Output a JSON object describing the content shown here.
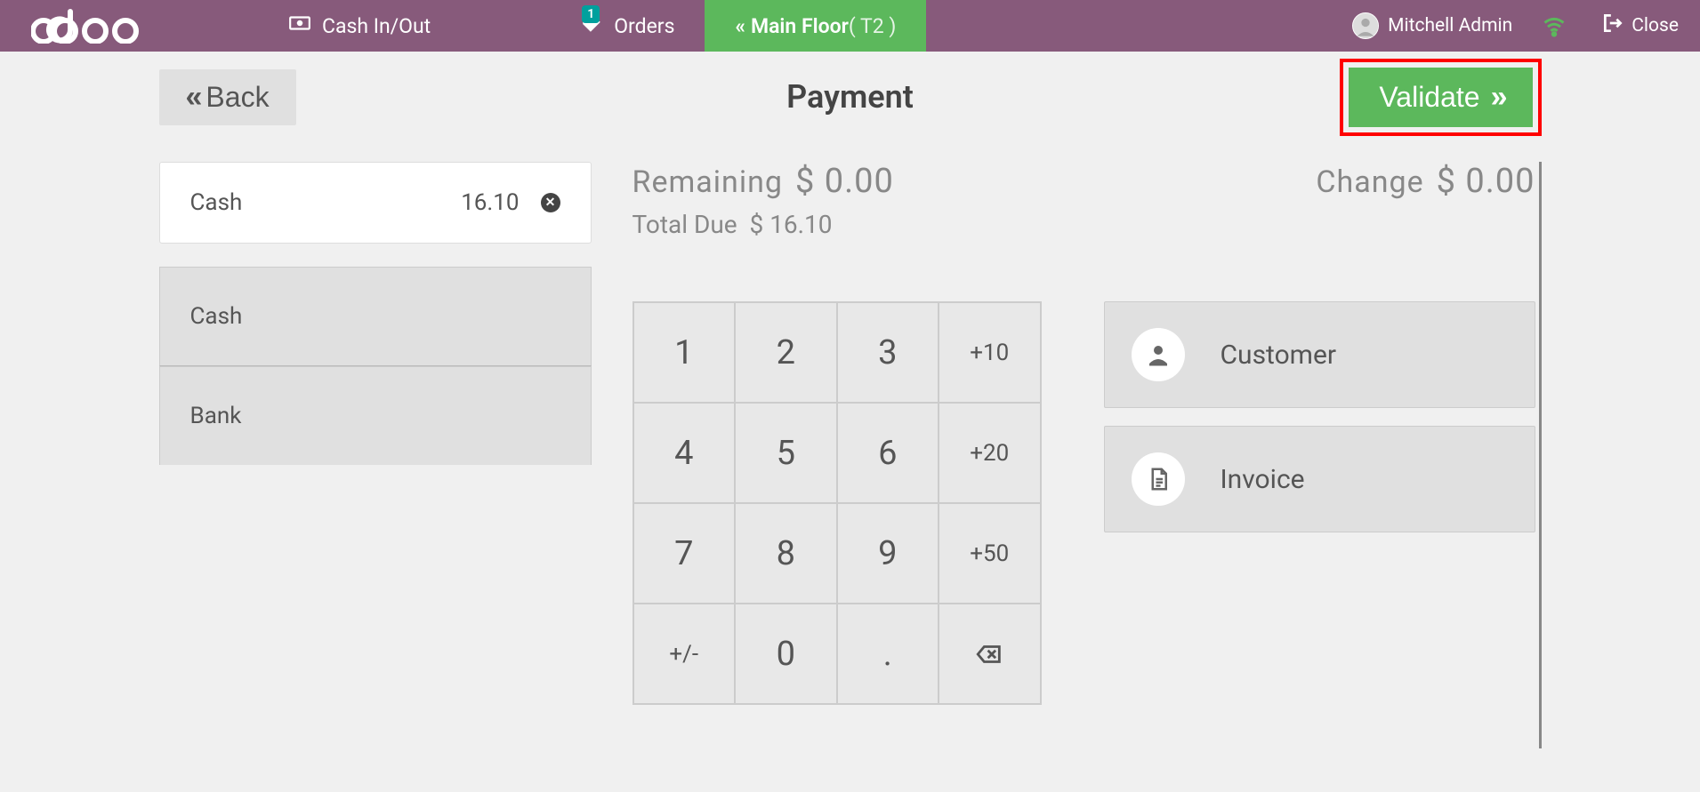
{
  "header": {
    "cash_label": "Cash In/Out",
    "orders_label": "Orders",
    "orders_badge": "1",
    "floor_label": "Main Floor",
    "floor_table": "( T2 )",
    "user": "Mitchell Admin",
    "close_label": "Close"
  },
  "top": {
    "back_label": "Back",
    "title": "Payment",
    "validate_label": "Validate"
  },
  "payment_line": {
    "method": "Cash",
    "amount": "16.10"
  },
  "methods": [
    "Cash",
    "Bank"
  ],
  "status": {
    "remaining_label": "Remaining",
    "remaining_value": "$ 0.00",
    "change_label": "Change",
    "change_value": "$ 0.00",
    "total_label": "Total Due",
    "total_value": "$ 16.10"
  },
  "keypad": {
    "r1": [
      "1",
      "2",
      "3",
      "+10"
    ],
    "r2": [
      "4",
      "5",
      "6",
      "+20"
    ],
    "r3": [
      "7",
      "8",
      "9",
      "+50"
    ],
    "r4": [
      "+/-",
      "0",
      ".",
      "⌫"
    ]
  },
  "actions": {
    "customer": "Customer",
    "invoice": "Invoice"
  }
}
